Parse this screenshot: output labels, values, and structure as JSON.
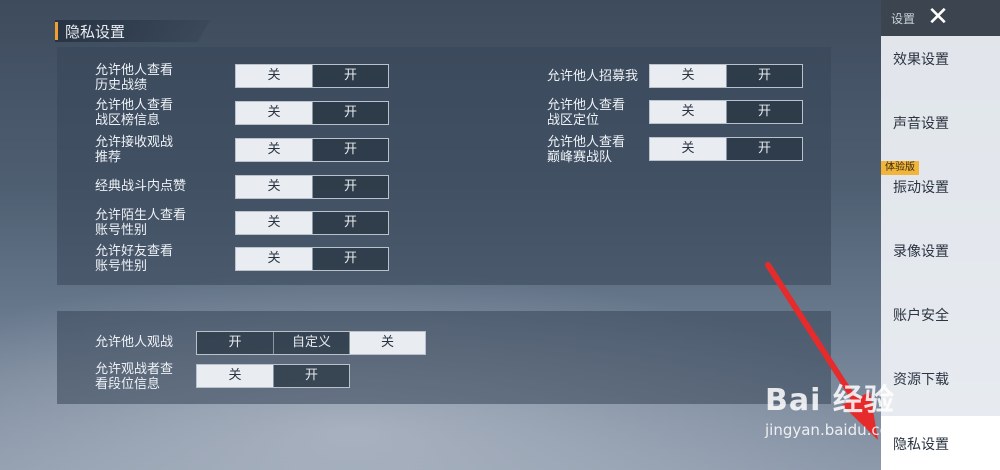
{
  "header": {
    "title": "隐私设置"
  },
  "left_rows": [
    {
      "label": "允许他人查看\n历史战绩",
      "off": "关",
      "on": "开"
    },
    {
      "label": "允许他人查看\n战区榜信息",
      "off": "关",
      "on": "开"
    },
    {
      "label": "允许接收观战\n推荐",
      "off": "关",
      "on": "开"
    },
    {
      "label": "经典战斗内点赞",
      "off": "关",
      "on": "开"
    },
    {
      "label": "允许陌生人查看\n账号性别",
      "off": "关",
      "on": "开"
    },
    {
      "label": "允许好友查看\n账号性别",
      "off": "关",
      "on": "开"
    }
  ],
  "right_rows": [
    {
      "label": "允许他人招募我",
      "off": "关",
      "on": "开"
    },
    {
      "label": "允许他人查看\n战区定位",
      "off": "关",
      "on": "开"
    },
    {
      "label": "允许他人查看\n巅峰赛战队",
      "off": "关",
      "on": "开"
    }
  ],
  "spectate": {
    "label": "允许他人观战",
    "options": [
      "开",
      "自定义",
      "关"
    ],
    "selected": "关"
  },
  "spectate_rank": {
    "label": "允许观战者查\n看段位信息",
    "off": "关",
    "on": "开"
  },
  "sidebar": {
    "title": "设置",
    "close": "✕",
    "badge": "体验版",
    "items": [
      {
        "label": "效果设置"
      },
      {
        "label": "声音设置"
      },
      {
        "label": "振动设置"
      },
      {
        "label": "录像设置"
      },
      {
        "label": "账户安全"
      },
      {
        "label": "资源下载"
      },
      {
        "label": "隐私设置"
      }
    ],
    "active_item": "隐私设置"
  },
  "watermark": {
    "logo": "Bai 经验",
    "url": "jingyan.baidu.com"
  },
  "colors": {
    "accent": "#f0a030",
    "arrow": "#e52b2b",
    "badge": "#f2b53b"
  }
}
